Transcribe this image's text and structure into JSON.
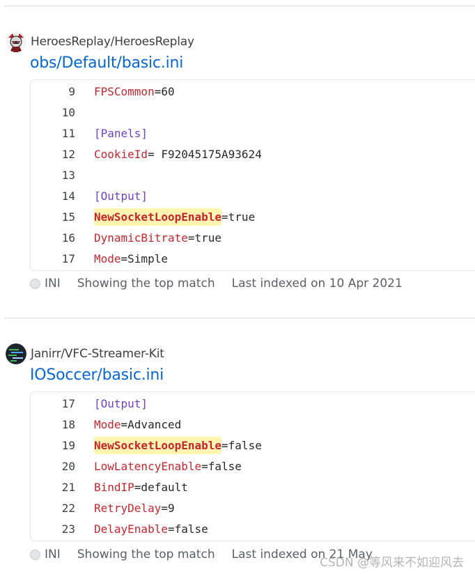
{
  "results": [
    {
      "repo": "HeroesReplay/HeroesReplay",
      "file_path": "obs/Default/basic.ini",
      "avatar_icon": "hero-avatar-icon",
      "lines": [
        {
          "num": "9",
          "tokens": [
            {
              "t": "key",
              "v": "FPSCommon"
            },
            {
              "t": "text",
              "v": "=60"
            }
          ]
        },
        {
          "num": "10",
          "tokens": []
        },
        {
          "num": "11",
          "tokens": [
            {
              "t": "section",
              "v": "[Panels]"
            }
          ]
        },
        {
          "num": "12",
          "tokens": [
            {
              "t": "key",
              "v": "CookieId"
            },
            {
              "t": "text",
              "v": "= F92045175A93624"
            }
          ]
        },
        {
          "num": "13",
          "tokens": []
        },
        {
          "num": "14",
          "tokens": [
            {
              "t": "section",
              "v": "[Output]"
            }
          ]
        },
        {
          "num": "15",
          "tokens": [
            {
              "t": "match",
              "v": "NewSocketLoopEnable"
            },
            {
              "t": "text",
              "v": "=true"
            }
          ]
        },
        {
          "num": "16",
          "tokens": [
            {
              "t": "key",
              "v": "DynamicBitrate"
            },
            {
              "t": "text",
              "v": "=true"
            }
          ]
        },
        {
          "num": "17",
          "tokens": [
            {
              "t": "key",
              "v": "Mode"
            },
            {
              "t": "text",
              "v": "=Simple"
            }
          ]
        }
      ],
      "language": "INI",
      "match_note": "Showing the top match",
      "indexed": "Last indexed on 10 Apr 2021"
    },
    {
      "repo": "Janirr/VFC-Streamer-Kit",
      "file_path": "IOSoccer/basic.ini",
      "avatar_icon": "terminal-avatar-icon",
      "lines": [
        {
          "num": "17",
          "tokens": [
            {
              "t": "section",
              "v": "[Output]"
            }
          ]
        },
        {
          "num": "18",
          "tokens": [
            {
              "t": "key",
              "v": "Mode"
            },
            {
              "t": "text",
              "v": "=Advanced"
            }
          ]
        },
        {
          "num": "19",
          "tokens": [
            {
              "t": "match",
              "v": "NewSocketLoopEnable"
            },
            {
              "t": "text",
              "v": "=false"
            }
          ]
        },
        {
          "num": "20",
          "tokens": [
            {
              "t": "key",
              "v": "LowLatencyEnable"
            },
            {
              "t": "text",
              "v": "=false"
            }
          ]
        },
        {
          "num": "21",
          "tokens": [
            {
              "t": "key",
              "v": "BindIP"
            },
            {
              "t": "text",
              "v": "=default"
            }
          ]
        },
        {
          "num": "22",
          "tokens": [
            {
              "t": "key",
              "v": "RetryDelay"
            },
            {
              "t": "text",
              "v": "=9"
            }
          ]
        },
        {
          "num": "23",
          "tokens": [
            {
              "t": "key",
              "v": "DelayEnable"
            },
            {
              "t": "text",
              "v": "=false"
            }
          ]
        }
      ],
      "language": "INI",
      "match_note": "Showing the top match",
      "indexed": "Last indexed on 21 May"
    }
  ],
  "watermark": "CSDN @等风来不如迎风去",
  "colors": {
    "link": "#0366d6",
    "key": "#c4262e",
    "section": "#6f42c1",
    "match_bg": "#fff5b1"
  }
}
